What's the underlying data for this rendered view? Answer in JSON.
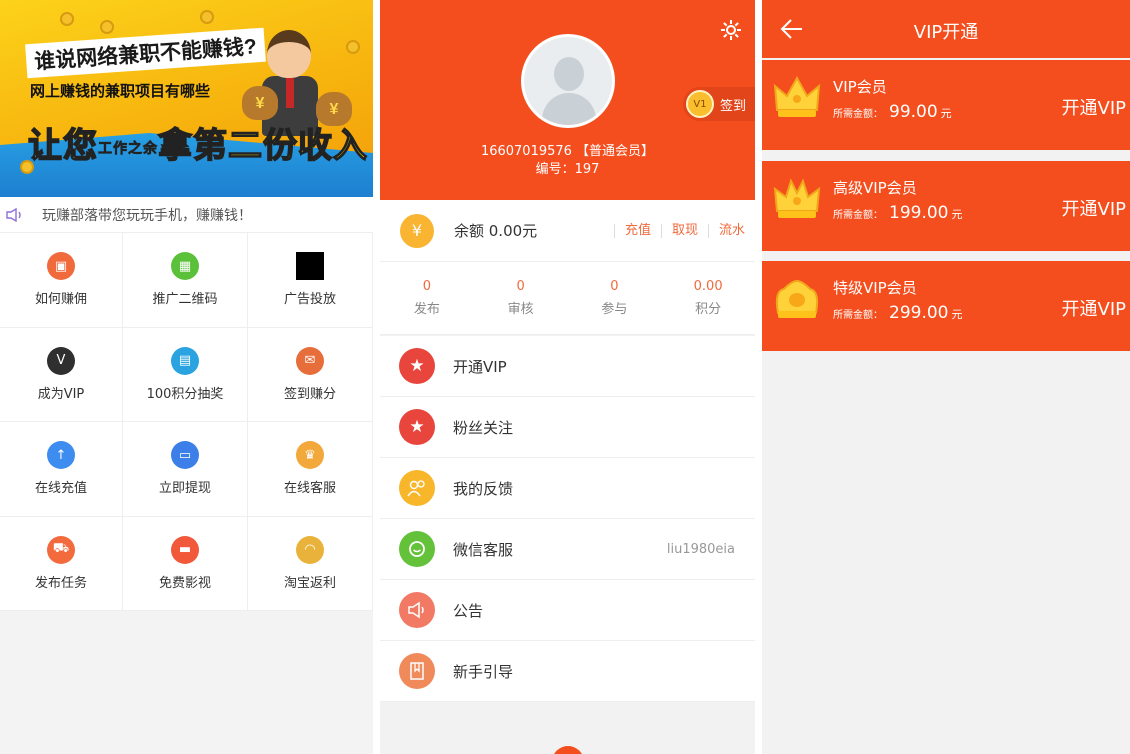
{
  "home": {
    "banner": {
      "line1": "谁说网络兼职不能赚钱?",
      "line2": "网上赚钱的兼职项目有哪些",
      "line3_a": "让您",
      "line3_small": "工作之余",
      "line3_b": "拿第二份收入"
    },
    "notice": "玩赚部落带您玩玩手机，赚赚钱！",
    "grid": [
      {
        "label": "如何赚佣",
        "icon": "gift-icon",
        "color": "#f06a3c"
      },
      {
        "label": "推广二维码",
        "icon": "qrcode-icon",
        "color": "#5cc13a"
      },
      {
        "label": "广告投放",
        "icon": "ad-image-icon",
        "color": "#000000"
      },
      {
        "label": "成为VIP",
        "icon": "vip-badge-icon",
        "color": "#2f2f2f"
      },
      {
        "label": "100积分抽奖",
        "icon": "lottery-icon",
        "color": "#2aa3e0"
      },
      {
        "label": "签到赚分",
        "icon": "checkin-icon",
        "color": "#e76d3a"
      },
      {
        "label": "在线充值",
        "icon": "rocket-icon",
        "color": "#3d8df1"
      },
      {
        "label": "立即提现",
        "icon": "card-icon",
        "color": "#3c7fe8"
      },
      {
        "label": "在线客服",
        "icon": "service-icon",
        "color": "#f2a83a"
      },
      {
        "label": "发布任务",
        "icon": "cart-icon",
        "color": "#f36b3d"
      },
      {
        "label": "免费影视",
        "icon": "film-icon",
        "color": "#f2593a"
      },
      {
        "label": "淘宝返利",
        "icon": "headset-icon",
        "color": "#e9b23a"
      }
    ]
  },
  "profile": {
    "phone": "16607019576 【普通会员】",
    "id_line": "编号：197",
    "level_badge": "V1",
    "sign_label": "签到",
    "balance": "余额 0.00元",
    "balance_actions": [
      "充值",
      "取现",
      "流水"
    ],
    "stats": [
      {
        "value": "0",
        "label": "发布"
      },
      {
        "value": "0",
        "label": "审核"
      },
      {
        "value": "0",
        "label": "参与"
      },
      {
        "value": "0.00",
        "label": "积分"
      }
    ],
    "menu": [
      {
        "label": "开通VIP",
        "value": "",
        "icon": "star-icon",
        "color": "#e8453c"
      },
      {
        "label": "粉丝关注",
        "value": "",
        "icon": "star-icon",
        "color": "#e8453c"
      },
      {
        "label": "我的反馈",
        "value": "",
        "icon": "users-icon",
        "color": "#f8b72a"
      },
      {
        "label": "微信客服",
        "value": "liu1980eia",
        "icon": "wechat-icon",
        "color": "#64c23a"
      },
      {
        "label": "公告",
        "value": "",
        "icon": "speaker-icon",
        "color": "#f27a64"
      },
      {
        "label": "新手引导",
        "value": "",
        "icon": "book-icon",
        "color": "#f08a5a"
      }
    ]
  },
  "vip": {
    "title": "VIP开通",
    "plans": [
      {
        "name": "VIP会员",
        "price_label": "所需金额：",
        "price": "99.00",
        "unit": "元",
        "action": "开通VIP",
        "icon": "crown-icon"
      },
      {
        "name": "高级VIP会员",
        "price_label": "所需金额：",
        "price": "199.00",
        "unit": "元",
        "action": "开通VIP",
        "icon": "crown-icon"
      },
      {
        "name": "特级VIP会员",
        "price_label": "所需金额：",
        "price": "299.00",
        "unit": "元",
        "action": "开通VIP",
        "icon": "crown-icon"
      }
    ]
  },
  "colors": {
    "accent": "#f44e1f",
    "link": "#f06a3c"
  }
}
